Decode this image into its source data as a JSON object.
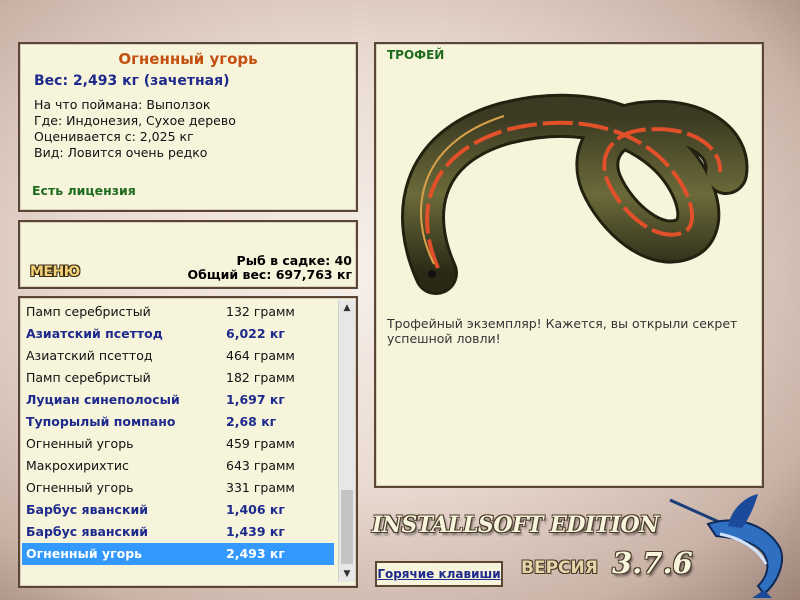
{
  "fish_info": {
    "name": "Огненный угорь",
    "weight": "Вес: 2,493 кг (зачетная)",
    "details": [
      "На что поймана: Выползок",
      "Где: Индонезия, Сухое дерево",
      "Оценивается с: 2,025 кг",
      "Вид: Ловится очень редко"
    ],
    "license": "Есть лицензия"
  },
  "stats": {
    "menu_label": "МЕНЮ",
    "fish_in_keepnet": "Рыб в садке: 40",
    "total_weight": "Общий вес: 697,763 кг"
  },
  "catch_list": [
    {
      "name": "Памп серебристый",
      "weight": "132 грамм",
      "style": "normal"
    },
    {
      "name": "Азиатский псеттод",
      "weight": "6,022 кг",
      "style": "bold"
    },
    {
      "name": "Азиатский псеттод",
      "weight": "464 грамм",
      "style": "normal"
    },
    {
      "name": "Памп серебристый",
      "weight": "182 грамм",
      "style": "normal"
    },
    {
      "name": "Луциан синеполосый",
      "weight": "1,697 кг",
      "style": "bold"
    },
    {
      "name": "Тупорылый помпано",
      "weight": "2,68 кг",
      "style": "bold"
    },
    {
      "name": "Огненный угорь",
      "weight": "459 грамм",
      "style": "normal"
    },
    {
      "name": "Макрохирихтис",
      "weight": "643 грамм",
      "style": "normal"
    },
    {
      "name": "Огненный угорь",
      "weight": "331 грамм",
      "style": "normal"
    },
    {
      "name": "Барбус яванский",
      "weight": "1,406 кг",
      "style": "bold"
    },
    {
      "name": "Барбус яванский",
      "weight": "1,439 кг",
      "style": "bold"
    },
    {
      "name": "Огненный угорь",
      "weight": "2,493 кг",
      "style": "selected"
    }
  ],
  "trophy": {
    "title": "ТРОФЕЙ",
    "description": "Трофейный экземпляр! Кажется, вы открыли секрет успешной ловли!"
  },
  "footer": {
    "edition": "INSTALLSOFT EDITION",
    "version_word": "ВЕРСИЯ",
    "version_number": "3.7.6",
    "hotkeys_label": "Горячие клавиши"
  },
  "colors": {
    "panel_bg": "#f7f4dc",
    "fish_name": "#c4500f",
    "weight_blue": "#1e2a8c",
    "license_green": "#1e6b1e",
    "selection": "#3399ff"
  },
  "icons": [
    "scroll-up-arrow-icon",
    "scroll-down-arrow-icon",
    "marlin-logo-icon"
  ]
}
